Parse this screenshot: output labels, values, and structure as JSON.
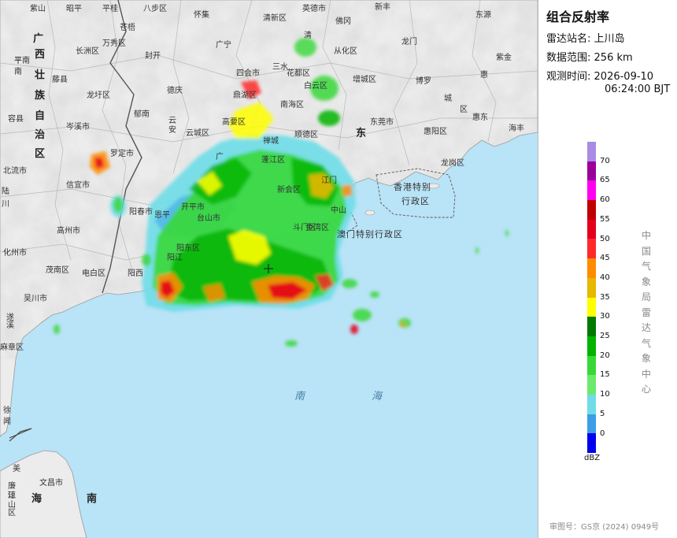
{
  "panel": {
    "title": "组合反射率",
    "station_label": "雷达站名:",
    "station_value": "上川岛",
    "range_label": "数据范围:",
    "range_value": "256 km",
    "time_label": "观测时间:",
    "time_date": "2026-09-10",
    "time_clock": "06:24:00 BJT",
    "unit": "dBZ",
    "org_vertical": "中国气象局雷达气象中心",
    "approval": "审图号：GS京 (2024) 0949号"
  },
  "scale": {
    "colors": [
      "#a98be4",
      "#9a009a",
      "#ff00f0",
      "#c00000",
      "#e4001c",
      "#ff2a2a",
      "#ff8c00",
      "#e6b800",
      "#ffff00",
      "#007a00",
      "#00b400",
      "#39d839",
      "#6dea6d",
      "#6fdde8",
      "#3a9fe8",
      "#0000f0"
    ],
    "ticks": [
      "70",
      "65",
      "60",
      "55",
      "50",
      "45",
      "40",
      "35",
      "30",
      "25",
      "20",
      "15",
      "10",
      "5",
      "0"
    ]
  },
  "labels": [
    {
      "t": "紫山",
      "k": ""
    },
    {
      "t": "昭平",
      "k": ""
    },
    {
      "t": "平桂",
      "k": ""
    },
    {
      "t": "八步区",
      "k": ""
    },
    {
      "t": "怀集",
      "k": ""
    },
    {
      "t": "清新区",
      "k": ""
    },
    {
      "t": "英德市",
      "k": ""
    },
    {
      "t": "新丰",
      "k": ""
    },
    {
      "t": "东源",
      "k": ""
    },
    {
      "t": "苍梧",
      "k": ""
    },
    {
      "t": "万秀区",
      "k": ""
    },
    {
      "t": "长洲区",
      "k": ""
    },
    {
      "t": "封开",
      "k": ""
    },
    {
      "t": "广宁",
      "k": ""
    },
    {
      "t": "佛冈",
      "k": ""
    },
    {
      "t": "从化区",
      "k": ""
    },
    {
      "t": "龙门",
      "k": ""
    },
    {
      "t": "紫金",
      "k": ""
    },
    {
      "t": "平南",
      "k": ""
    },
    {
      "t": "藤县",
      "k": ""
    },
    {
      "t": "四会市",
      "k": ""
    },
    {
      "t": "花都区",
      "k": ""
    },
    {
      "t": "增城区",
      "k": ""
    },
    {
      "t": "博罗",
      "k": ""
    },
    {
      "t": "惠",
      "k": ""
    },
    {
      "t": "龙圩区",
      "k": ""
    },
    {
      "t": "德庆",
      "k": ""
    },
    {
      "t": "鼎湖区",
      "k": ""
    },
    {
      "t": "白云区",
      "k": ""
    },
    {
      "t": "南海区",
      "k": ""
    },
    {
      "t": "城",
      "k": ""
    },
    {
      "t": "区",
      "k": ""
    },
    {
      "t": "容县",
      "k": ""
    },
    {
      "t": "岑溪市",
      "k": ""
    },
    {
      "t": "郁南",
      "k": ""
    },
    {
      "t": "云",
      "k": ""
    },
    {
      "t": "安",
      "k": ""
    },
    {
      "t": "云城区",
      "k": ""
    },
    {
      "t": "高要区",
      "k": ""
    },
    {
      "t": "顺德区",
      "k": ""
    },
    {
      "t": "东莞市",
      "k": ""
    },
    {
      "t": "惠东",
      "k": ""
    },
    {
      "t": "惠阳区",
      "k": ""
    },
    {
      "t": "海丰",
      "k": ""
    },
    {
      "t": "罗定市",
      "k": ""
    },
    {
      "t": "北流市",
      "k": ""
    },
    {
      "t": "信宜市",
      "k": ""
    },
    {
      "t": "阳春市",
      "k": ""
    },
    {
      "t": "开平市",
      "k": ""
    },
    {
      "t": "龙岗区",
      "k": ""
    },
    {
      "t": "高州市",
      "k": ""
    },
    {
      "t": "台山市",
      "k": ""
    },
    {
      "t": "斗门区",
      "k": ""
    },
    {
      "t": "金湾区",
      "k": ""
    },
    {
      "t": "化州市",
      "k": ""
    },
    {
      "t": "阳东区",
      "k": ""
    },
    {
      "t": "茂南区",
      "k": ""
    },
    {
      "t": "电白区",
      "k": ""
    },
    {
      "t": "阳西",
      "k": ""
    },
    {
      "t": "吴川市",
      "k": ""
    },
    {
      "t": "麻章区",
      "k": ""
    },
    {
      "t": "徐",
      "k": ""
    },
    {
      "t": "闻",
      "k": ""
    },
    {
      "t": "文昌市",
      "k": ""
    },
    {
      "t": "蓬江区",
      "k": ""
    },
    {
      "t": "新会区",
      "k": ""
    },
    {
      "t": "江门",
      "k": ""
    },
    {
      "t": "恩平",
      "k": ""
    },
    {
      "t": "阳江",
      "k": ""
    },
    {
      "t": "清",
      "k": ""
    },
    {
      "t": "三水",
      "k": ""
    },
    {
      "t": "禅城",
      "k": ""
    },
    {
      "t": "中山",
      "k": ""
    },
    {
      "t": "广",
      "k": ""
    },
    {
      "t": "东",
      "k": "big"
    },
    {
      "t": "广",
      "k": "big"
    },
    {
      "t": "西",
      "k": "big"
    },
    {
      "t": "壮",
      "k": "big"
    },
    {
      "t": "族",
      "k": "big"
    },
    {
      "t": "自",
      "k": "big"
    },
    {
      "t": "治",
      "k": "big"
    },
    {
      "t": "区",
      "k": "big"
    },
    {
      "t": "海",
      "k": "big"
    },
    {
      "t": "南",
      "k": "big"
    },
    {
      "t": "南",
      "k": "sea"
    },
    {
      "t": "海",
      "k": "sea"
    },
    {
      "t": "香港特别",
      "k": "sar"
    },
    {
      "t": "行政区",
      "k": "sar"
    },
    {
      "t": "澳门特别行政区",
      "k": "sar"
    },
    {
      "t": "平",
      "k": ""
    },
    {
      "t": "南",
      "k": ""
    },
    {
      "t": "陆",
      "k": ""
    },
    {
      "t": "川",
      "k": ""
    },
    {
      "t": "廉",
      "k": ""
    },
    {
      "t": "江",
      "k": ""
    },
    {
      "t": "遂",
      "k": ""
    },
    {
      "t": "溪",
      "k": ""
    },
    {
      "t": "美",
      "k": ""
    },
    {
      "t": "琼",
      "k": ""
    },
    {
      "t": "山",
      "k": ""
    },
    {
      "t": "区",
      "k": ""
    }
  ]
}
